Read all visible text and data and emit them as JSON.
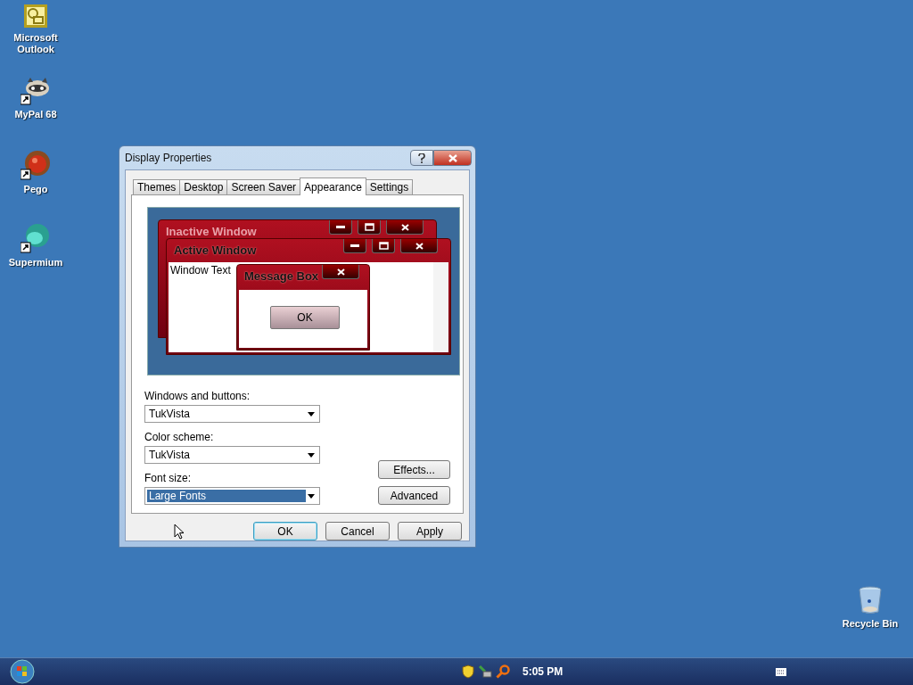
{
  "desktop_icons": [
    {
      "label": "Microsoft Outlook",
      "kind": "outlook"
    },
    {
      "label": "MyPal 68",
      "kind": "raccoon"
    },
    {
      "label": "Pego",
      "kind": "orb"
    },
    {
      "label": "Supermium",
      "kind": "sphere"
    },
    {
      "label": "Recycle Bin",
      "kind": "bin"
    }
  ],
  "dialog": {
    "title": "Display Properties",
    "tabs": [
      {
        "label": "Themes",
        "selected": false
      },
      {
        "label": "Desktop",
        "selected": false
      },
      {
        "label": "Screen Saver",
        "selected": false
      },
      {
        "label": "Appearance",
        "selected": true
      },
      {
        "label": "Settings",
        "selected": false
      }
    ],
    "preview": {
      "inactive_title": "Inactive Window",
      "active_title": "Active Window",
      "window_text": "Window Text",
      "message_title": "Message Box",
      "ok_label": "OK"
    },
    "fields": [
      {
        "label": "Windows and buttons:",
        "value": "TukVista",
        "highlighted": false
      },
      {
        "label": "Color scheme:",
        "value": "TukVista",
        "highlighted": false
      },
      {
        "label": "Font size:",
        "value": "Large Fonts",
        "highlighted": true
      }
    ],
    "side_buttons": [
      "Effects...",
      "Advanced"
    ],
    "buttons": [
      {
        "label": "OK",
        "default": true
      },
      {
        "label": "Cancel",
        "default": false
      },
      {
        "label": "Apply",
        "default": false
      }
    ]
  },
  "taskbar": {
    "clock": "5:05 PM"
  }
}
